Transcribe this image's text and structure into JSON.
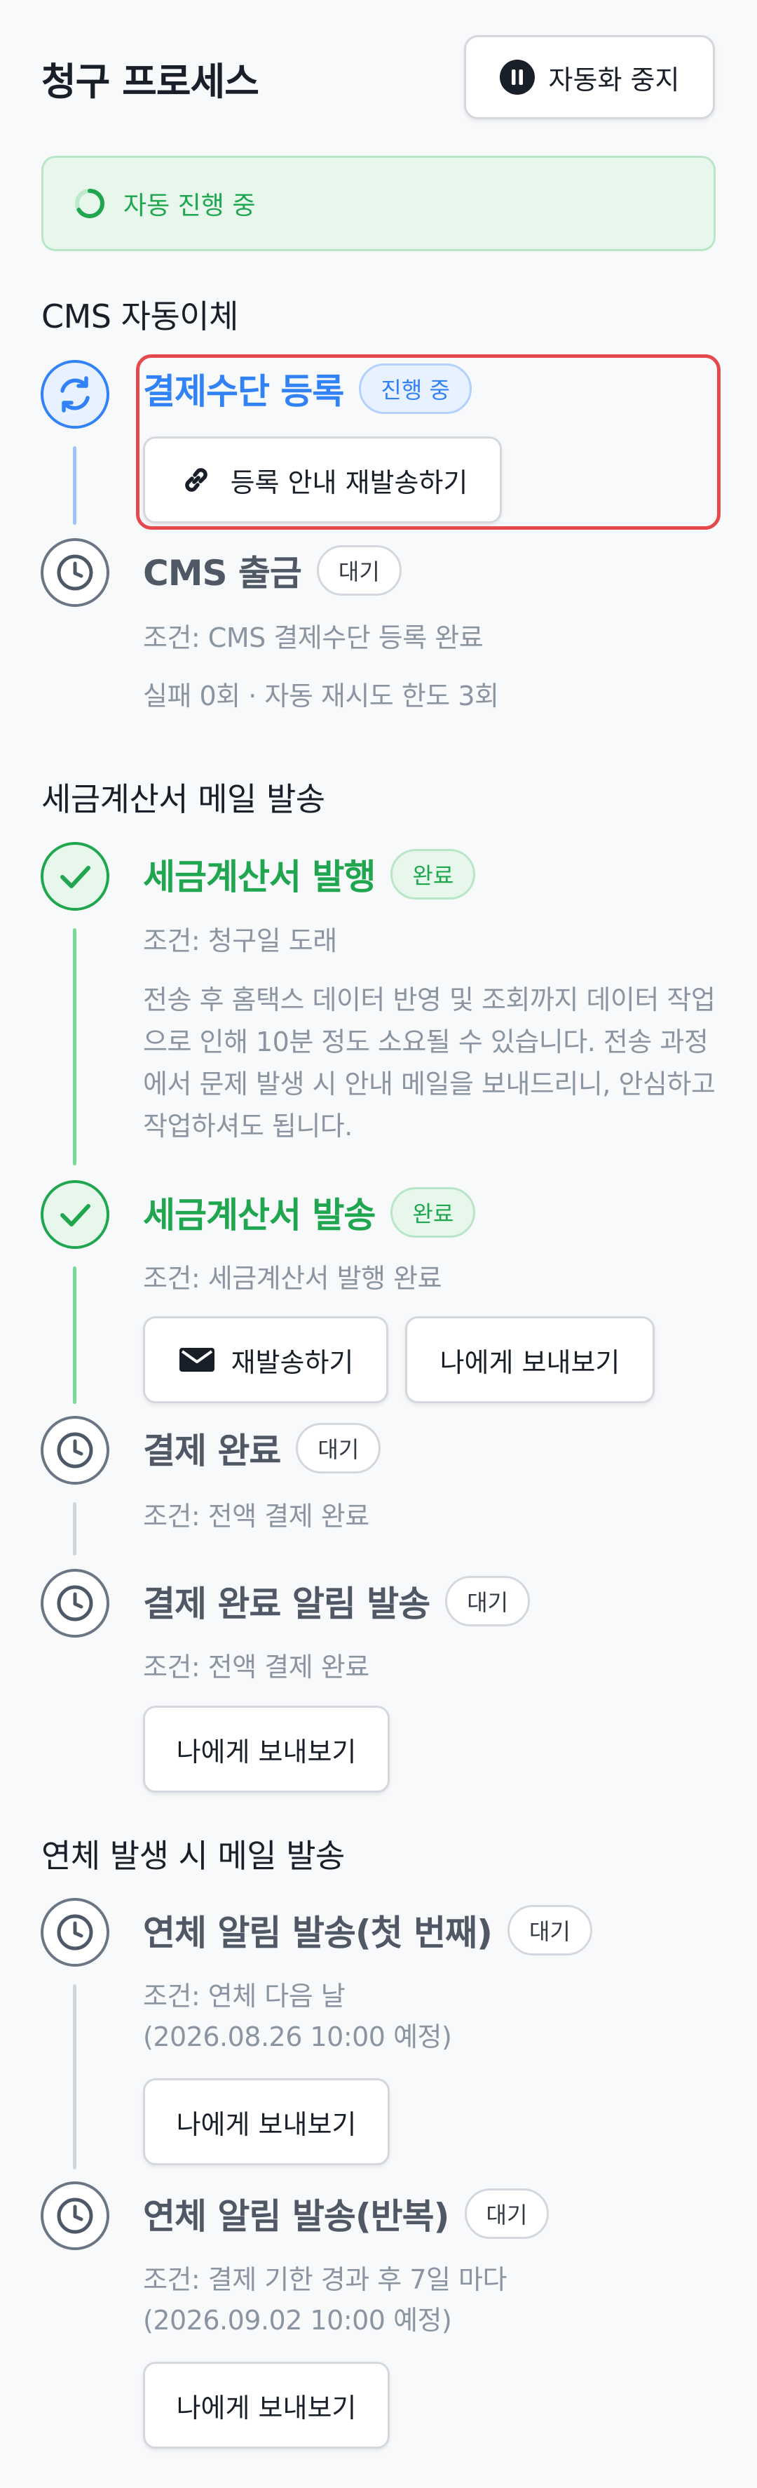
{
  "header": {
    "title": "청구 프로세스",
    "pause_label": "자동화 중지"
  },
  "status": {
    "label": "자동 진행 중"
  },
  "colors": {
    "accent_blue": "#3182f6",
    "success_green": "#1fa64f",
    "pending_gray": "#8b95a1",
    "highlight_red": "#e5484d"
  },
  "sections": [
    {
      "title": "CMS 자동이체",
      "steps": [
        {
          "title": "결제수단 등록",
          "badge": "진행 중",
          "icon": "refresh-icon",
          "button": "등록 안내 재발송하기",
          "button_icon": "link-icon"
        },
        {
          "title": "CMS 출금",
          "badge": "대기",
          "icon": "clock-icon",
          "detail1": "조건: CMS 결제수단 등록 완료",
          "detail2": "실패 0회 · 자동 재시도 한도 3회"
        }
      ]
    },
    {
      "title": "세금계산서 메일 발송",
      "steps": [
        {
          "title": "세금계산서 발행",
          "badge": "완료",
          "icon": "check-icon",
          "detail1": "조건: 청구일 도래",
          "detail2": "전송 후 홈택스 데이터 반영 및 조회까지 데이터 작업으로 인해 10분 정도 소요될 수 있습니다. 전송 과정에서 문제 발생 시 안내 메일을 보내드리니, 안심하고 작업하셔도 됩니다."
        },
        {
          "title": "세금계산서 발송",
          "badge": "완료",
          "icon": "check-icon",
          "detail1": "조건: 세금계산서 발행 완료",
          "button1": "재발송하기",
          "button1_icon": "mail-icon",
          "button2": "나에게 보내보기"
        },
        {
          "title": "결제 완료",
          "badge": "대기",
          "icon": "clock-icon",
          "detail1": "조건: 전액 결제 완료"
        },
        {
          "title": "결제 완료 알림 발송",
          "badge": "대기",
          "icon": "clock-icon",
          "detail1": "조건: 전액 결제 완료",
          "button": "나에게 보내보기"
        }
      ]
    },
    {
      "title": "연체 발생 시 메일 발송",
      "steps": [
        {
          "title": "연체 알림 발송(첫 번째)",
          "badge": "대기",
          "icon": "clock-icon",
          "detail1": "조건: 연체 다음 날",
          "detail2": "(2026.08.26 10:00 예정)",
          "button": "나에게 보내보기"
        },
        {
          "title": "연체 알림 발송(반복)",
          "badge": "대기",
          "icon": "clock-icon",
          "detail1": "조건: 결제 기한 경과 후 7일 마다",
          "detail2": "(2026.09.02 10:00 예정)",
          "button": "나에게 보내보기"
        }
      ]
    }
  ]
}
